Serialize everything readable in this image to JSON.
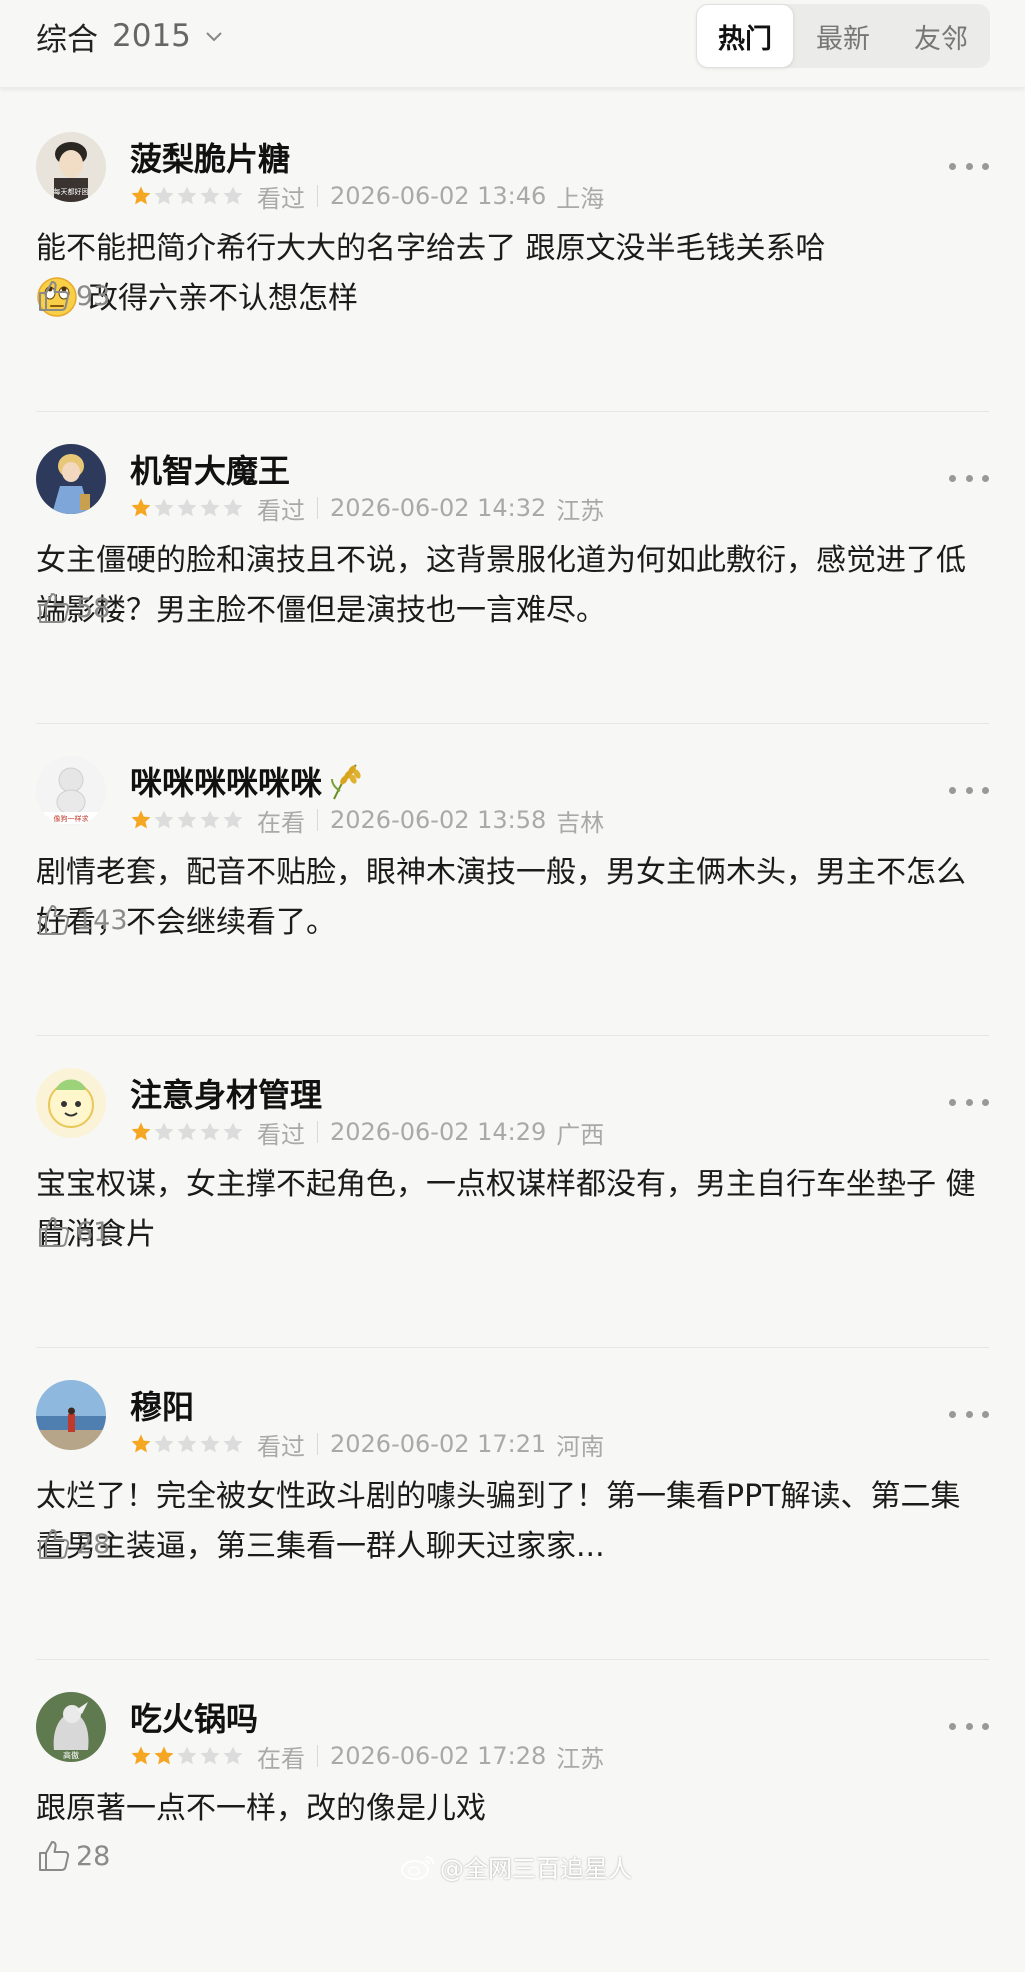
{
  "header": {
    "filter_label": "综合",
    "filter_year": "2015",
    "tabs": [
      "热门",
      "最新",
      "友邻"
    ],
    "active_tab": "热门"
  },
  "reviews": [
    {
      "user": "菠梨脆片糖",
      "rating": 1,
      "status": "看过",
      "datetime": "2026-06-02 13:46",
      "location": "上海",
      "text": "能不能把简介希行大大的名字给去了 跟原文没半毛钱关系哈",
      "text2": "改得六亲不认想怎样",
      "likes": "93",
      "avatar_caption": "每天都好困"
    },
    {
      "user": "机智大魔王",
      "rating": 1,
      "status": "看过",
      "datetime": "2026-06-02 14:32",
      "location": "江苏",
      "text": "女主僵硬的脸和演技且不说，这背景服化道为何如此敷衍，感觉进了低端影楼？男主脸不僵但是演技也一言难尽。",
      "likes": "58"
    },
    {
      "user": "咪咪咪咪咪咪",
      "rating": 1,
      "status": "在看",
      "datetime": "2026-06-02 13:58",
      "location": "吉林",
      "text": "剧情老套，配音不贴脸，眼神木演技一般，男女主俩木头，男主不怎么好看，不会继续看了。",
      "likes": "143",
      "avatar_caption": "像狗一样求"
    },
    {
      "user": "注意身材管理",
      "rating": 1,
      "status": "看过",
      "datetime": "2026-06-02 14:29",
      "location": "广西",
      "text": "宝宝权谋，女主撑不起角色，一点权谋样都没有，男主自行车坐垫子 健胃消食片",
      "likes": "61"
    },
    {
      "user": "穆阳",
      "rating": 1,
      "status": "看过",
      "datetime": "2026-06-02 17:21",
      "location": "河南",
      "text": "太烂了！完全被女性政斗剧的噱头骗到了！第一集看PPT解读、第二集看男主装逼，第三集看一群人聊天过家家...",
      "likes": "28"
    },
    {
      "user": "吃火锅吗",
      "rating": 2,
      "status": "在看",
      "datetime": "2026-06-02 17:28",
      "location": "江苏",
      "text": "跟原著一点不一样，改的像是儿戏",
      "likes": "28",
      "avatar_caption": "高傲"
    }
  ],
  "watermark": "@全网三百追星人",
  "colors": {
    "star_on": "#f5a623",
    "star_off": "#dcdcdc",
    "meta": "#a9a9a9"
  }
}
